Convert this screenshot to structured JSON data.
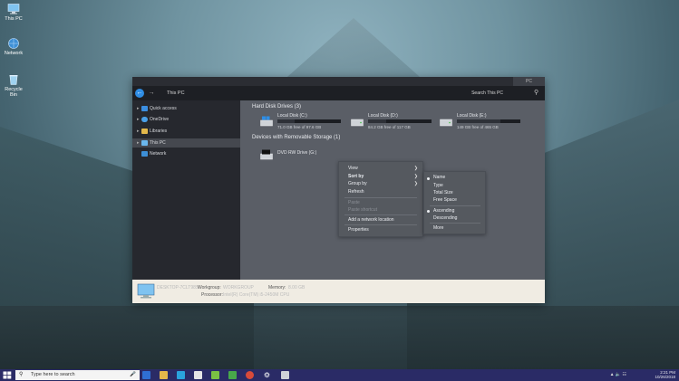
{
  "desktop": {
    "icons": [
      {
        "label": "This PC"
      },
      {
        "label": "Network"
      },
      {
        "label": "Recycle Bin"
      }
    ]
  },
  "window": {
    "tab_label": "PC",
    "address": "This PC",
    "search_placeholder": "Search This PC",
    "sidebar": [
      {
        "label": "Quick access"
      },
      {
        "label": "OneDrive"
      },
      {
        "label": "Libraries"
      },
      {
        "label": "This PC"
      },
      {
        "label": "Network"
      }
    ],
    "hard_disk_header": "Hard Disk Drives (3)",
    "removable_header": "Devices with Removable Storage (1)",
    "drives": [
      {
        "name": "Local Disk (C:)",
        "free": "71.0 GB free of 97.6 GB",
        "used": 0.27
      },
      {
        "name": "Local Disk (D:)",
        "free": "84.2 GB free of 117 GB",
        "used": 0.28
      },
      {
        "name": "Local Disk (E:)",
        "free": "149 GB free of 465 GB",
        "used": 0.68
      }
    ],
    "dvd": {
      "name": "DVD RW Drive (G:)"
    },
    "details": {
      "computer_name": "DESKTOP-7CLT98S",
      "workgroup_label": "Workgroup:",
      "workgroup_value": "WORKGROUP",
      "processor_label": "Processor:",
      "processor_value": "Intel(R) Core(TM) i5-2450M CPU",
      "memory_label": "Memory:",
      "memory_value": "8.00 GB"
    }
  },
  "context_menu": {
    "items": [
      {
        "label": "View"
      },
      {
        "label": "Sort by"
      },
      {
        "label": "Group by"
      },
      {
        "label": "Refresh"
      },
      {
        "label": "Paste"
      },
      {
        "label": "Paste shortcut"
      },
      {
        "label": "Add a network location"
      },
      {
        "label": "Properties"
      }
    ]
  },
  "sort_menu": {
    "items": [
      {
        "label": "Name"
      },
      {
        "label": "Type"
      },
      {
        "label": "Total Size"
      },
      {
        "label": "Free Space"
      },
      {
        "label": "Ascending"
      },
      {
        "label": "Descending"
      },
      {
        "label": "More"
      }
    ]
  },
  "taskbar": {
    "search_placeholder": "Type here to search",
    "time": "2:21 PM",
    "date": "10/26/2018"
  },
  "colors": {
    "accent": "#2f8de4",
    "taskbar": "#2a2b66",
    "sidebar": "#26282e",
    "content": "#5a5e66"
  }
}
